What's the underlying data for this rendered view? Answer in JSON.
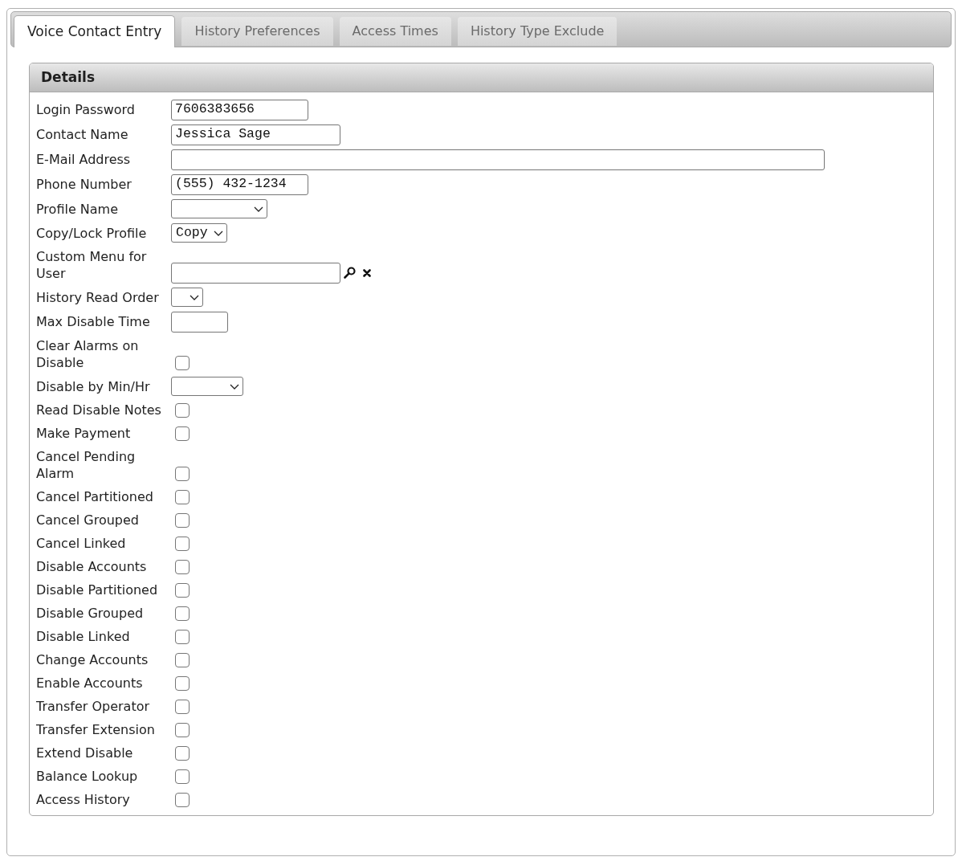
{
  "tabs": [
    {
      "label": "Voice Contact Entry",
      "selected": true
    },
    {
      "label": "History Preferences",
      "selected": false
    },
    {
      "label": "Access Times",
      "selected": false
    },
    {
      "label": "History Type Exclude",
      "selected": false
    }
  ],
  "panel": {
    "title": "Details",
    "rows": [
      {
        "label": "Login Password",
        "kind": "text",
        "value": "7606383656"
      },
      {
        "label": "Contact Name",
        "kind": "text",
        "value": "Jessica Sage"
      },
      {
        "label": "E-Mail Address",
        "kind": "text"
      },
      {
        "label": "Phone Number",
        "kind": "text",
        "value": "(555) 432-1234"
      },
      {
        "label": "Profile Name",
        "kind": "select"
      },
      {
        "label": "Copy/Lock Profile",
        "kind": "select",
        "value": "Copy"
      },
      {
        "label": "Custom Menu for User",
        "kind": "lookup"
      },
      {
        "label": "History Read Order",
        "kind": "select"
      },
      {
        "label": "Max Disable Time",
        "kind": "text"
      },
      {
        "label": "Clear Alarms on Disable",
        "kind": "checkbox",
        "checked": false
      },
      {
        "label": "Disable by Min/Hr",
        "kind": "select"
      },
      {
        "label": "Read Disable Notes",
        "kind": "checkbox",
        "checked": false
      },
      {
        "label": "Make Payment",
        "kind": "checkbox",
        "checked": false
      },
      {
        "label": "Cancel Pending Alarm",
        "kind": "checkbox",
        "checked": false
      },
      {
        "label": "Cancel Partitioned",
        "kind": "checkbox",
        "checked": false
      },
      {
        "label": "Cancel Grouped",
        "kind": "checkbox",
        "checked": false
      },
      {
        "label": "Cancel Linked",
        "kind": "checkbox",
        "checked": false
      },
      {
        "label": "Disable Accounts",
        "kind": "checkbox",
        "checked": false
      },
      {
        "label": "Disable Partitioned",
        "kind": "checkbox",
        "checked": false
      },
      {
        "label": "Disable Grouped",
        "kind": "checkbox",
        "checked": false
      },
      {
        "label": "Disable Linked",
        "kind": "checkbox",
        "checked": false
      },
      {
        "label": "Change Accounts",
        "kind": "checkbox",
        "checked": false
      },
      {
        "label": "Enable Accounts",
        "kind": "checkbox",
        "checked": false
      },
      {
        "label": "Transfer Operator",
        "kind": "checkbox",
        "checked": false
      },
      {
        "label": "Transfer Extension",
        "kind": "checkbox",
        "checked": false
      },
      {
        "label": "Extend Disable",
        "kind": "checkbox",
        "checked": false
      },
      {
        "label": "Balance Lookup",
        "kind": "checkbox",
        "checked": false
      },
      {
        "label": "Access History",
        "kind": "checkbox",
        "checked": false
      }
    ]
  }
}
